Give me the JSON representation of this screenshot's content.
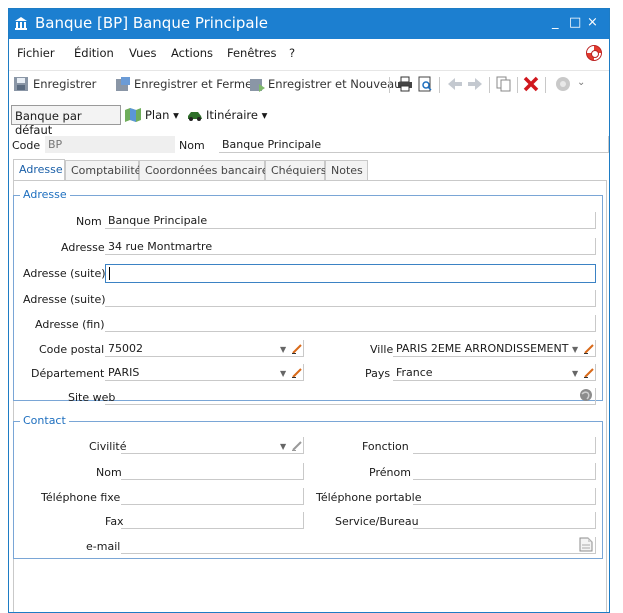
{
  "window": {
    "title": "Banque [BP] Banque Principale",
    "minimize": "_",
    "maximize": "□",
    "close": "×"
  },
  "menu": [
    "Fichier",
    "Édition",
    "Vues",
    "Actions",
    "Fenêtres",
    "?"
  ],
  "toolbar": {
    "save": "Enregistrer",
    "save_close": "Enregistrer et Fermer",
    "save_new": "Enregistrer et Nouveau"
  },
  "subbar": {
    "default_bank": "Banque par défaut",
    "plan": "Plan",
    "itinerary": "Itinéraire"
  },
  "header": {
    "code_label": "Code",
    "code_value": "BP",
    "name_label": "Nom",
    "name_value": "Banque Principale"
  },
  "tabs": [
    "Adresse",
    "Comptabilité",
    "Coordonnées bancaires",
    "Chéquiers",
    "Notes"
  ],
  "address": {
    "group_title": "Adresse",
    "nom_label": "Nom",
    "nom_value": "Banque Principale",
    "adresse_label": "Adresse",
    "adresse_value": "34 rue Montmartre",
    "suite1_label": "Adresse (suite)",
    "suite1_value": "",
    "suite2_label": "Adresse (suite)",
    "suite2_value": "",
    "fin_label": "Adresse (fin)",
    "fin_value": "",
    "cp_label": "Code postal",
    "cp_value": "75002",
    "ville_label": "Ville",
    "ville_value": "PARIS 2EME ARRONDISSEMENT",
    "dept_label": "Département",
    "dept_value": "PARIS",
    "pays_label": "Pays",
    "pays_value": "France",
    "site_label": "Site web",
    "site_value": ""
  },
  "contact": {
    "group_title": "Contact",
    "civilite_label": "Civilité",
    "civilite_value": "",
    "fonction_label": "Fonction",
    "fonction_value": "",
    "nom_label": "Nom",
    "nom_value": "",
    "prenom_label": "Prénom",
    "prenom_value": "",
    "tel_fixe_label": "Téléphone fixe",
    "tel_fixe_value": "",
    "tel_port_label": "Téléphone portable",
    "tel_port_value": "",
    "fax_label": "Fax",
    "fax_value": "",
    "service_label": "Service/Bureau",
    "service_value": "",
    "email_label": "e-mail",
    "email_value": ""
  },
  "colors": {
    "titlebar": "#1c7fd0",
    "group_title": "#1e6fbf",
    "close_red": "#d0171d"
  }
}
